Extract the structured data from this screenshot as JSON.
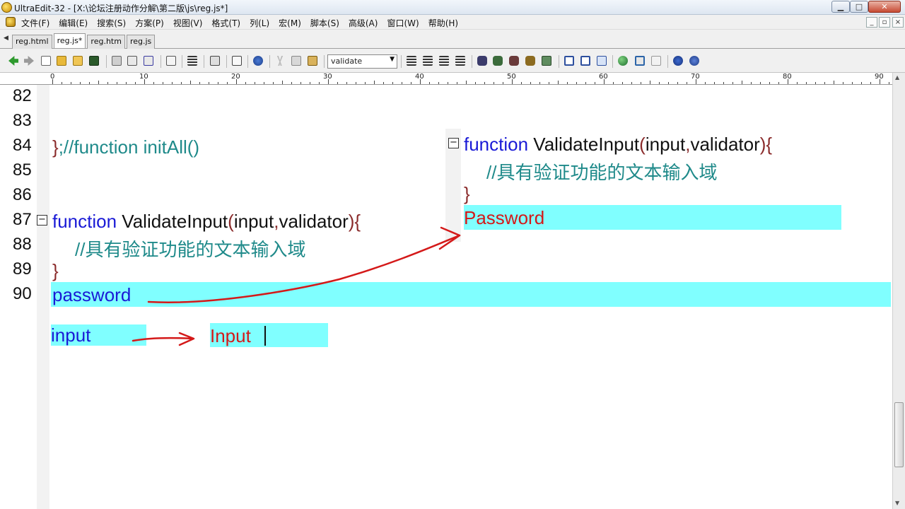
{
  "window": {
    "title": "UltraEdit-32 - [X:\\论坛注册动作分解\\第二版\\js\\reg.js*]",
    "min_glyph": "▁",
    "max_glyph": "□",
    "close_glyph": "✕"
  },
  "menu": {
    "items": [
      "文件(F)",
      "编辑(E)",
      "搜索(S)",
      "方案(P)",
      "视图(V)",
      "格式(T)",
      "列(L)",
      "宏(M)",
      "脚本(S)",
      "高级(A)",
      "窗口(W)",
      "帮助(H)"
    ],
    "mdi_min": "_",
    "mdi_restore": "▫",
    "mdi_close": "×"
  },
  "tabs": [
    {
      "label": "reg.html",
      "active": false
    },
    {
      "label": "reg.js*",
      "active": true
    },
    {
      "label": "reg.htm",
      "active": false
    },
    {
      "label": "reg.js",
      "active": false
    }
  ],
  "tabbar": {
    "arrow": "◀"
  },
  "toolbar": {
    "combo_value": "validate",
    "combo_arrow": "▼"
  },
  "ruler": {
    "labels": [
      "0",
      "10",
      "20",
      "30",
      "40",
      "50",
      "60",
      "70",
      "80",
      "90"
    ]
  },
  "scrollbar": {
    "up": "▲",
    "down": "▼"
  },
  "gutter": {
    "lines": [
      "82",
      "83",
      "84",
      "85",
      "86",
      "87",
      "88",
      "89",
      "90"
    ]
  },
  "code": {
    "line84_brace": "}",
    "line84_comment": ";//function initAll()",
    "line87_kw": "function",
    "line87_name": " ValidateInput",
    "line87_open": "(",
    "line87_p1": "input",
    "line87_comma": ",",
    "line87_p2": "validator",
    "line87_close": "){",
    "line88_comment": "//具有验证功能的文本输入域",
    "line89_brace": "}",
    "line90_text": "password",
    "extra_input": "input"
  },
  "fold_glyph": "−",
  "popup": {
    "kw": "function",
    "name": " ValidateInput",
    "open": "(",
    "p1": "input",
    "comma": ",",
    "p2": "validator",
    "close": "){",
    "comment": "//具有验证功能的文本输入域",
    "brace": "}",
    "highlight": "Password"
  },
  "annotation": {
    "result_text": "Input"
  }
}
